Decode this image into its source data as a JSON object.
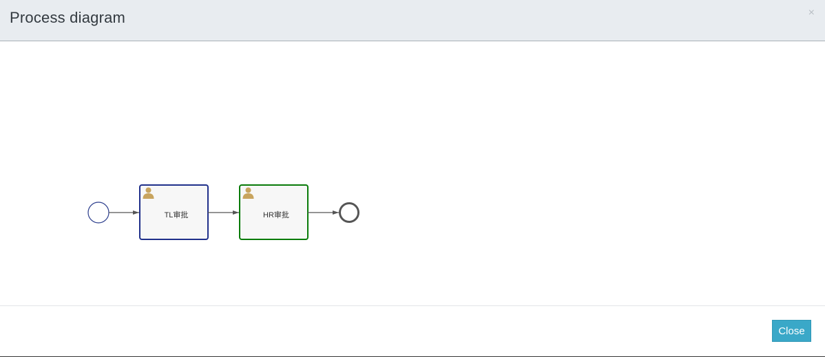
{
  "dialog": {
    "title": "Process diagram",
    "close_icon": "×",
    "close_button_label": "Close"
  },
  "diagram": {
    "tasks": [
      {
        "label": "TL审批",
        "icon": "user-icon",
        "border_color": "#1f2f8a"
      },
      {
        "label": "HR审批",
        "icon": "user-icon",
        "border_color": "#087a08"
      }
    ],
    "colors": {
      "start_event": "#2a3c8c",
      "end_event": "#555555",
      "flow": "#555555",
      "task_fill": "#f7f7f7",
      "user_icon": "#c8a45e",
      "button": "#3aa8c8"
    }
  }
}
